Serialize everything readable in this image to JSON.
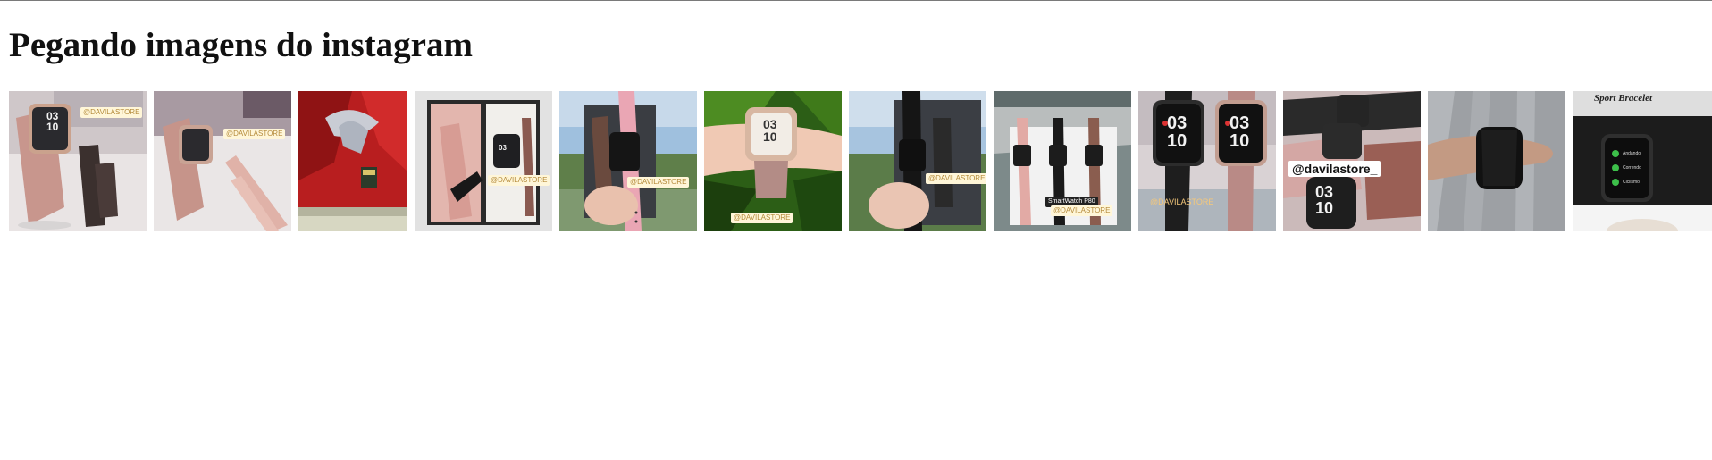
{
  "page": {
    "title": "Pegando imagens do instagram"
  },
  "gallery": {
    "photos": [
      {
        "id": 1,
        "tag": "@DAVILASTORE",
        "screen": "03\n10",
        "theme": "pink-band-store"
      },
      {
        "id": 2,
        "tag": "@DAVILASTORE",
        "screen": "",
        "theme": "pink-band-store"
      },
      {
        "id": 3,
        "tag": "",
        "screen": "",
        "theme": "red-gift-wrap"
      },
      {
        "id": 4,
        "tag": "@DAVILASTORE",
        "screen": "03",
        "theme": "pink-band-box"
      },
      {
        "id": 5,
        "tag": "@DAVILASTORE",
        "screen": "",
        "theme": "hand-sky-pink"
      },
      {
        "id": 6,
        "tag": "@DAVILASTORE",
        "screen": "03\n10",
        "theme": "wrist-green"
      },
      {
        "id": 7,
        "tag": "@DAVILASTORE",
        "screen": "",
        "theme": "hand-sky-black"
      },
      {
        "id": 8,
        "tag": "@DAVILASTORE",
        "label": "SmartWatch P80",
        "screen": "",
        "theme": "three-bands"
      },
      {
        "id": 9,
        "tag": "@DAVILASTORE",
        "screen": "03\n10",
        "theme": "two-watches"
      },
      {
        "id": 10,
        "tag": "@davilastore_",
        "screen": "03\n10",
        "theme": "pile-watches"
      },
      {
        "id": 11,
        "tag": "",
        "screen": "",
        "theme": "hand-gray"
      },
      {
        "id": 12,
        "tag": "",
        "banner": "Sport Bracelet",
        "menu": [
          "Andando",
          "Correndo",
          "Ciclismo"
        ],
        "theme": "box-screen"
      }
    ]
  }
}
